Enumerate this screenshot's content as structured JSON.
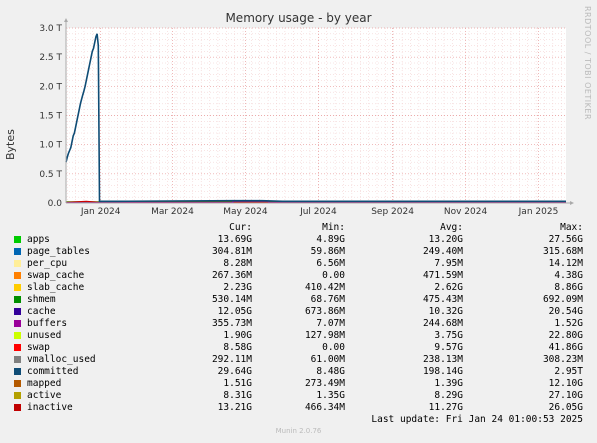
{
  "chart_data": {
    "type": "line",
    "title": "Memory usage - by year",
    "ylabel": "Bytes",
    "side_label": "RRDTOOL / TOBI OETIKER",
    "y_ticks": [
      {
        "label": "0.0",
        "value": 0
      },
      {
        "label": "0.5 T",
        "value": 0.5
      },
      {
        "label": "1.0 T",
        "value": 1.0
      },
      {
        "label": "1.5 T",
        "value": 1.5
      },
      {
        "label": "2.0 T",
        "value": 2.0
      },
      {
        "label": "2.5 T",
        "value": 2.5
      },
      {
        "label": "3.0 T",
        "value": 3.0
      }
    ],
    "ylim": [
      0,
      3.0
    ],
    "x_range": [
      "2023-12-03",
      "2025-01-24"
    ],
    "x_ticks": [
      {
        "label": "Jan 2024",
        "date": "2024-01-01"
      },
      {
        "label": "Mar 2024",
        "date": "2024-03-01"
      },
      {
        "label": "May 2024",
        "date": "2024-05-01"
      },
      {
        "label": "Jul 2024",
        "date": "2024-07-01"
      },
      {
        "label": "Sep 2024",
        "date": "2024-09-01"
      },
      {
        "label": "Nov 2024",
        "date": "2024-11-01"
      },
      {
        "label": "Jan 2025",
        "date": "2025-01-01"
      }
    ],
    "grid": true,
    "series": [
      {
        "name": "committed",
        "color": "#0f4c75",
        "points": [
          [
            "2023-12-03",
            0.7
          ],
          [
            "2023-12-04",
            0.78
          ],
          [
            "2023-12-05",
            0.85
          ],
          [
            "2023-12-06",
            0.9
          ],
          [
            "2023-12-07",
            0.95
          ],
          [
            "2023-12-08",
            1.05
          ],
          [
            "2023-12-09",
            1.15
          ],
          [
            "2023-12-10",
            1.2
          ],
          [
            "2023-12-11",
            1.3
          ],
          [
            "2023-12-12",
            1.4
          ],
          [
            "2023-12-13",
            1.5
          ],
          [
            "2023-12-14",
            1.6
          ],
          [
            "2023-12-15",
            1.7
          ],
          [
            "2023-12-16",
            1.78
          ],
          [
            "2023-12-17",
            1.85
          ],
          [
            "2023-12-18",
            1.92
          ],
          [
            "2023-12-19",
            2.0
          ],
          [
            "2023-12-20",
            2.1
          ],
          [
            "2023-12-21",
            2.2
          ],
          [
            "2023-12-22",
            2.3
          ],
          [
            "2023-12-23",
            2.4
          ],
          [
            "2023-12-24",
            2.5
          ],
          [
            "2023-12-25",
            2.6
          ],
          [
            "2023-12-26",
            2.65
          ],
          [
            "2023-12-27",
            2.75
          ],
          [
            "2023-12-28",
            2.85
          ],
          [
            "2023-12-29",
            2.9
          ],
          [
            "2023-12-30",
            2.7
          ],
          [
            "2023-12-31",
            0.03
          ],
          [
            "2024-01-15",
            0.03
          ],
          [
            "2024-04-20",
            0.04
          ],
          [
            "2024-05-15",
            0.04
          ],
          [
            "2024-06-01",
            0.03
          ],
          [
            "2025-01-24",
            0.03
          ]
        ]
      },
      {
        "name": "apps",
        "color": "#00cc00",
        "points": [
          [
            "2023-12-03",
            0.02
          ],
          [
            "2025-01-24",
            0.02
          ]
        ]
      },
      {
        "name": "inactive",
        "color": "#cc0000",
        "points": [
          [
            "2023-12-03",
            0.01
          ],
          [
            "2023-12-20",
            0.03
          ],
          [
            "2023-12-31",
            0.01
          ],
          [
            "2025-01-24",
            0.01
          ]
        ]
      },
      {
        "name": "buffers",
        "color": "#990099",
        "points": [
          [
            "2023-12-03",
            0.005
          ],
          [
            "2024-04-20",
            0.005
          ],
          [
            "2024-04-21",
            0.03
          ],
          [
            "2024-05-20",
            0.03
          ],
          [
            "2024-05-21",
            0.005
          ],
          [
            "2025-01-24",
            0.005
          ]
        ]
      }
    ]
  },
  "legend": {
    "headers": {
      "cur": "Cur:",
      "min": "Min:",
      "avg": "Avg:",
      "max": "Max:"
    },
    "rows": [
      {
        "name": "apps",
        "color": "#00cc00",
        "cur": "13.69G",
        "min": "4.89G",
        "avg": "13.20G",
        "max": "27.56G"
      },
      {
        "name": "page_tables",
        "color": "#0066b3",
        "cur": "304.81M",
        "min": "59.86M",
        "avg": "249.40M",
        "max": "315.68M"
      },
      {
        "name": "per_cpu",
        "color": "#ffee99",
        "cur": "8.28M",
        "min": "6.56M",
        "avg": "7.95M",
        "max": "14.12M"
      },
      {
        "name": "swap_cache",
        "color": "#ff8000",
        "cur": "267.36M",
        "min": "0.00",
        "avg": "471.59M",
        "max": "4.38G"
      },
      {
        "name": "slab_cache",
        "color": "#ffcc00",
        "cur": "2.23G",
        "min": "410.42M",
        "avg": "2.62G",
        "max": "8.86G"
      },
      {
        "name": "shmem",
        "color": "#008f00",
        "cur": "530.14M",
        "min": "68.76M",
        "avg": "475.43M",
        "max": "692.09M"
      },
      {
        "name": "cache",
        "color": "#330099",
        "cur": "12.05G",
        "min": "673.86M",
        "avg": "10.32G",
        "max": "20.54G"
      },
      {
        "name": "buffers",
        "color": "#990099",
        "cur": "355.73M",
        "min": "7.07M",
        "avg": "244.68M",
        "max": "1.52G"
      },
      {
        "name": "unused",
        "color": "#ccff00",
        "cur": "1.90G",
        "min": "127.98M",
        "avg": "3.75G",
        "max": "22.80G"
      },
      {
        "name": "swap",
        "color": "#ff0000",
        "cur": "8.58G",
        "min": "0.00",
        "avg": "9.57G",
        "max": "41.86G"
      },
      {
        "name": "vmalloc_used",
        "color": "#808080",
        "cur": "292.11M",
        "min": "61.00M",
        "avg": "238.13M",
        "max": "308.23M"
      },
      {
        "name": "committed",
        "color": "#0f4c75",
        "cur": "29.64G",
        "min": "8.48G",
        "avg": "198.14G",
        "max": "2.95T"
      },
      {
        "name": "mapped",
        "color": "#b35900",
        "cur": "1.51G",
        "min": "273.49M",
        "avg": "1.39G",
        "max": "12.10G"
      },
      {
        "name": "active",
        "color": "#b3a000",
        "cur": "8.31G",
        "min": "1.35G",
        "avg": "8.29G",
        "max": "27.10G"
      },
      {
        "name": "inactive",
        "color": "#c00000",
        "cur": "13.21G",
        "min": "466.34M",
        "avg": "11.27G",
        "max": "26.05G"
      }
    ]
  },
  "last_update": "Last update: Fri Jan 24 01:00:53 2025",
  "footer": "Munin 2.0.76"
}
